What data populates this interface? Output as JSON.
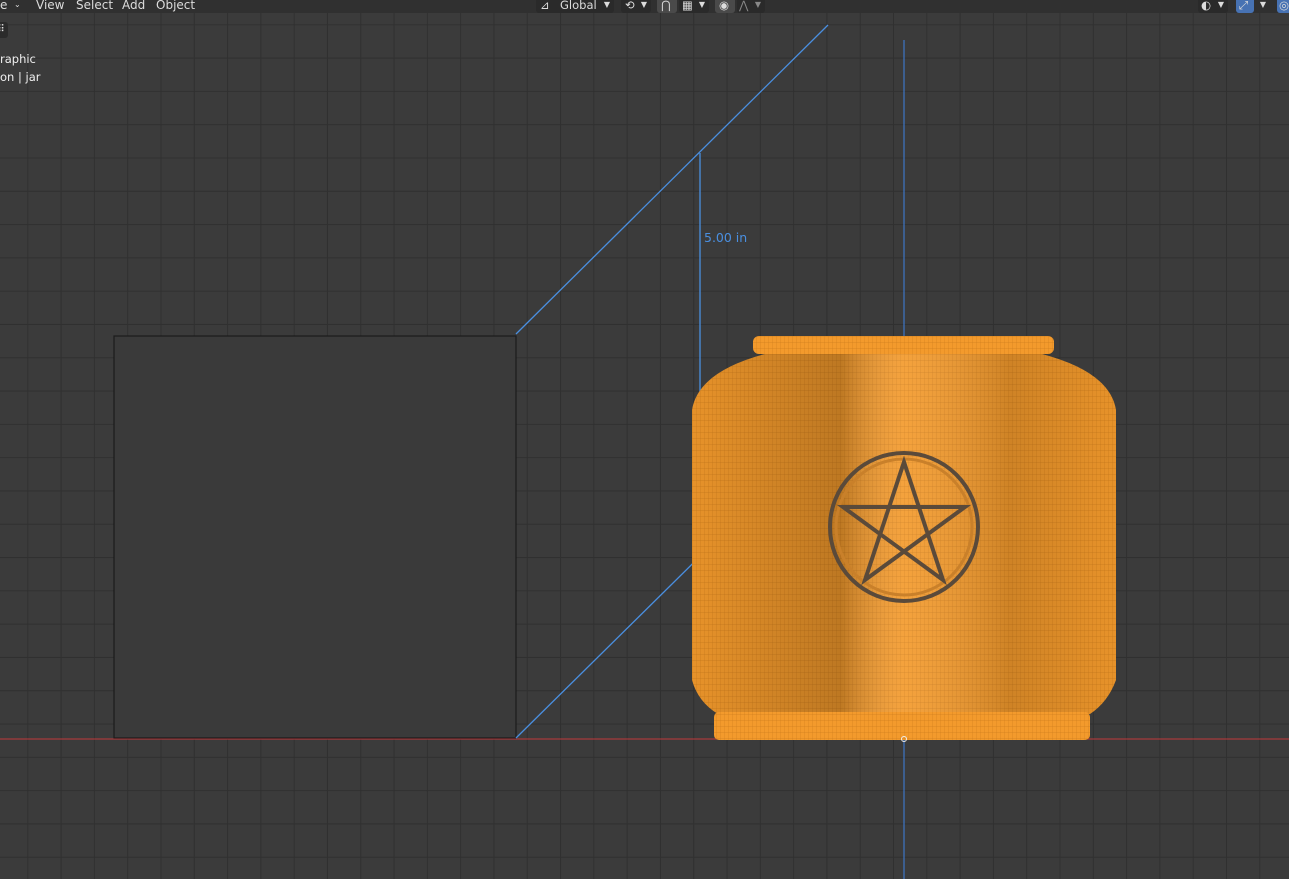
{
  "header": {
    "menu": {
      "partial": "e",
      "view": "View",
      "select": "Select",
      "add": "Add",
      "object": "Object"
    },
    "orientation": {
      "label": "Global"
    }
  },
  "overlay": {
    "view_name_fragment": "raphic",
    "collection_fragment": "on | jar"
  },
  "measurement": {
    "label": "5.00 in"
  },
  "colors": {
    "viewport_bg": "#3b3b3b",
    "grid_line": "#303030",
    "x_axis": "#c0393b",
    "z_axis": "#3d76c6",
    "measure_line": "#4a8fe0",
    "selected_object": "#f29e33",
    "plane": "#3a3a3a"
  },
  "icons": [
    "dropdown-chevron-icon",
    "orientation-icon",
    "pivot-icon",
    "snap-icon",
    "snap-target-icon",
    "proportional-edit-icon",
    "falloff-icon",
    "visibility-icon",
    "gizmo-icon",
    "overlay-icon",
    "toolbar-toggle-icon"
  ]
}
